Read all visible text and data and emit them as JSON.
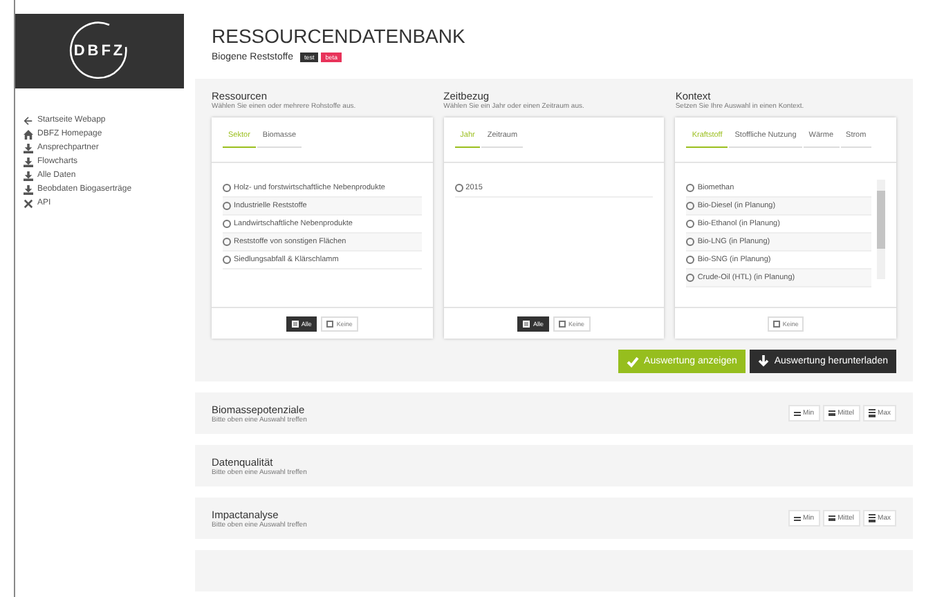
{
  "logo": {
    "text": "DBFZ"
  },
  "sidebar": {
    "items": [
      {
        "label": "Startseite Webapp",
        "kind": "back"
      },
      {
        "label": "DBFZ Homepage",
        "kind": "home"
      },
      {
        "label": "Ansprechpartner",
        "kind": "download"
      },
      {
        "label": "Flowcharts",
        "kind": "download"
      },
      {
        "label": "Alle Daten",
        "kind": "download"
      },
      {
        "label": "Beobdaten Biogaserträge",
        "kind": "download"
      },
      {
        "label": "API",
        "kind": "api"
      }
    ]
  },
  "header": {
    "title": "RESSOURCENDATENBANK",
    "subtitle": "Biogene Reststoffe",
    "badges": [
      {
        "text": "test",
        "color": "#333333"
      },
      {
        "text": "beta",
        "color": "#e8335a"
      }
    ]
  },
  "filters": [
    {
      "title": "Ressourcen",
      "hint": "Wählen Sie einen oder mehrere Rohstoffe aus.",
      "tabs": [
        {
          "label": "Sektor",
          "selected": true
        },
        {
          "label": "Biomasse",
          "selected": false
        }
      ],
      "options": [
        {
          "label": "Holz- und forstwirtschaftliche Nebenprodukte",
          "checked": false
        },
        {
          "label": "Industrielle Reststoffe",
          "checked": false
        },
        {
          "label": "Landwirtschaftliche Nebenprodukte",
          "checked": false
        },
        {
          "label": "Reststoffe von sonstigen Flächen",
          "checked": false
        },
        {
          "label": "Siedlungsabfall & Klärschlamm",
          "checked": false
        }
      ],
      "footer": [
        {
          "label": "Alle",
          "kind": "all"
        },
        {
          "label": "Keine",
          "kind": "none"
        }
      ]
    },
    {
      "title": "Zeitbezug",
      "hint": "Wählen Sie ein Jahr oder einen Zeitraum aus.",
      "tabs": [
        {
          "label": "Jahr",
          "selected": true
        },
        {
          "label": "Zeitraum",
          "selected": false
        }
      ],
      "options": [
        {
          "label": "2015",
          "checked": false
        }
      ],
      "footer": [
        {
          "label": "Alle",
          "kind": "all"
        },
        {
          "label": "Keine",
          "kind": "none"
        }
      ]
    },
    {
      "title": "Kontext",
      "hint": "Setzen Sie Ihre Auswahl in einen Kontext.",
      "tabs": [
        {
          "label": "Kraftstoff",
          "selected": true
        },
        {
          "label": "Stoffliche Nutzung",
          "selected": false
        },
        {
          "label": "Wärme",
          "selected": false
        },
        {
          "label": "Strom",
          "selected": false
        }
      ],
      "options": [
        {
          "label": "Biomethan",
          "checked": false
        },
        {
          "label": "Bio-Diesel (in Planung)",
          "checked": false
        },
        {
          "label": "Bio-Ethanol (in Planung)",
          "checked": false
        },
        {
          "label": "Bio-LNG (in Planung)",
          "checked": false
        },
        {
          "label": "Bio-SNG (in Planung)",
          "checked": false
        },
        {
          "label": "Crude-Oil (HTL) (in Planung)",
          "checked": false
        }
      ],
      "footer": [
        {
          "label": "Keine",
          "kind": "none"
        }
      ]
    }
  ],
  "actions": [
    {
      "label": "Auswertung anzeigen",
      "kind": "show"
    },
    {
      "label": "Auswertung herunterladen",
      "kind": "download"
    }
  ],
  "sections": [
    {
      "title": "Biomassepotenziale",
      "hint": "Bitte oben eine Auswahl treffen",
      "buttons": [
        {
          "label": "Min",
          "kind": "min"
        },
        {
          "label": "Mittel",
          "kind": "mid"
        },
        {
          "label": "Max",
          "kind": "max"
        }
      ]
    },
    {
      "title": "Datenqualität",
      "hint": "Bitte oben eine Auswahl treffen"
    },
    {
      "title": "Impactanalyse",
      "hint": "Bitte oben eine Auswahl treffen",
      "buttons": [
        {
          "label": "Min",
          "kind": "min"
        },
        {
          "label": "Mittel",
          "kind": "mid"
        },
        {
          "label": "Max",
          "kind": "max"
        }
      ]
    }
  ]
}
